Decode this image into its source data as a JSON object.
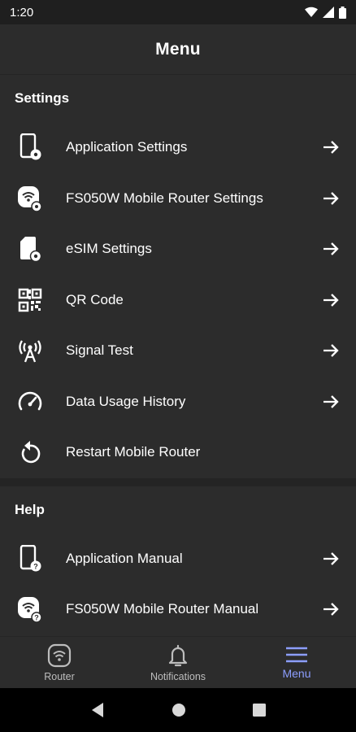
{
  "status_bar": {
    "time": "1:20"
  },
  "header": {
    "title": "Menu"
  },
  "sections": [
    {
      "title": "Settings",
      "items": [
        {
          "label": "Application Settings",
          "icon": "phone-gear-icon",
          "arrow": true
        },
        {
          "label": "FS050W Mobile Router Settings",
          "icon": "router-gear-icon",
          "arrow": true
        },
        {
          "label": "eSIM Settings",
          "icon": "sim-gear-icon",
          "arrow": true
        },
        {
          "label": "QR Code",
          "icon": "qr-code-icon",
          "arrow": true
        },
        {
          "label": "Signal Test",
          "icon": "antenna-icon",
          "arrow": true
        },
        {
          "label": "Data Usage History",
          "icon": "gauge-icon",
          "arrow": true
        },
        {
          "label": "Restart Mobile Router",
          "icon": "restart-icon",
          "arrow": false
        }
      ]
    },
    {
      "title": "Help",
      "items": [
        {
          "label": "Application Manual",
          "icon": "phone-help-icon",
          "arrow": true
        },
        {
          "label": "FS050W Mobile Router Manual",
          "icon": "router-help-icon",
          "arrow": true
        }
      ]
    }
  ],
  "bottom_nav": [
    {
      "label": "Router",
      "icon": "router-wifi-icon",
      "active": false
    },
    {
      "label": "Notifications",
      "icon": "bell-icon",
      "active": false
    },
    {
      "label": "Menu",
      "icon": "hamburger-icon",
      "active": true
    }
  ],
  "colors": {
    "background": "#2c2c2c",
    "accent": "#8c9eff",
    "text": "#ffffff"
  }
}
